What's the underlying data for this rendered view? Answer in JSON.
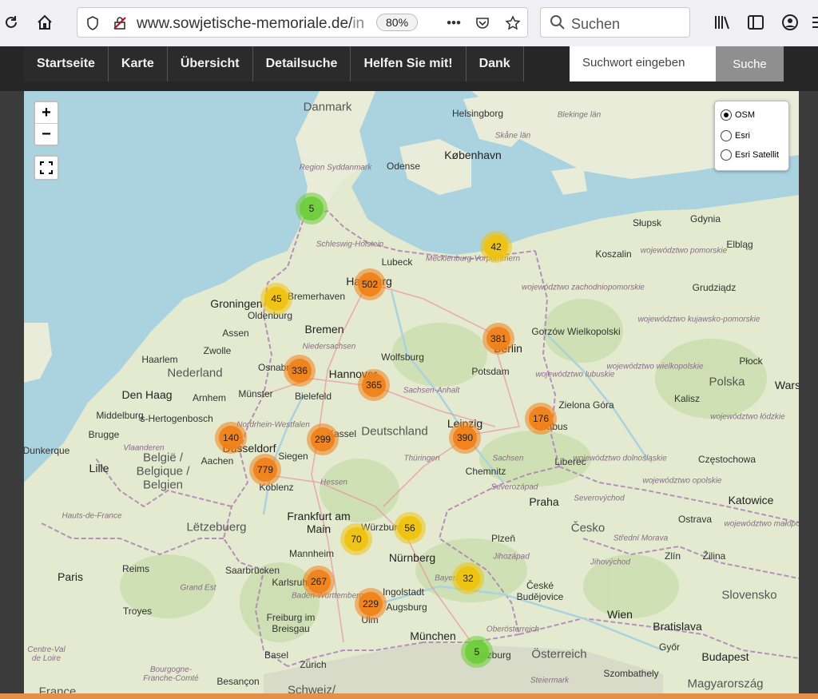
{
  "browser": {
    "url_main": "www.sowjetische-memoriale.de/",
    "url_fade": "in",
    "zoom": "80%",
    "search_placeholder": "Suchen"
  },
  "nav": {
    "items": [
      "Startseite",
      "Karte",
      "Übersicht",
      "Detailsuche",
      "Helfen Sie mit!",
      "Dank"
    ],
    "search_placeholder": "Suchwort eingeben",
    "search_button": "Suche"
  },
  "map": {
    "zoom_in": "+",
    "zoom_out": "−",
    "layers": [
      {
        "label": "OSM",
        "selected": true
      },
      {
        "label": "Esri",
        "selected": false
      },
      {
        "label": "Esri Satellit",
        "selected": false
      }
    ],
    "clusters": [
      {
        "count": "5",
        "size": "small"
      },
      {
        "count": "42",
        "size": "medium"
      },
      {
        "count": "502",
        "size": "large"
      },
      {
        "count": "45",
        "size": "medium"
      },
      {
        "count": "381",
        "size": "large"
      },
      {
        "count": "336",
        "size": "large"
      },
      {
        "count": "365",
        "size": "large"
      },
      {
        "count": "176",
        "size": "large"
      },
      {
        "count": "140",
        "size": "large"
      },
      {
        "count": "299",
        "size": "large"
      },
      {
        "count": "390",
        "size": "large"
      },
      {
        "count": "779",
        "size": "large"
      },
      {
        "count": "56",
        "size": "medium"
      },
      {
        "count": "70",
        "size": "medium"
      },
      {
        "count": "32",
        "size": "medium"
      },
      {
        "count": "267",
        "size": "large"
      },
      {
        "count": "229",
        "size": "large"
      },
      {
        "count": "5",
        "size": "small"
      }
    ],
    "labels": {
      "danmark": "Danmark",
      "helsingborg": "Helsingborg",
      "skane": "Skåne län",
      "kobenhavn": "København",
      "odense": "Odense",
      "syddanmark": "Region Syddanmark",
      "blekinge": "Blekinge län",
      "slupsk": "Słupsk",
      "gdynia": "Gdynia",
      "pomorskie": "województwo pomorskie",
      "elblag": "Elbląg",
      "koszalin": "Koszalin",
      "schleswig": "Schleswig-Holstein",
      "lubeck": "Lubeck",
      "mecklenburg": "Mecklenburg-Vorpommern",
      "zachodnio": "województwo zachodniopomorskie",
      "grudziadz": "Grudziądz",
      "groningen": "Groningen",
      "bremerhaven": "Bremerhaven",
      "hamburg": "Hamburg",
      "oldenburg": "Oldenburg",
      "bremen": "Bremen",
      "assen": "Assen",
      "kujawsko": "województwo kujawsko-pomorskie",
      "gorzow": "Gorzów Wielkopolski",
      "zwolle": "Zwolle",
      "niedersachsen": "Niedersachsen",
      "wolfsburg": "Wolfsburg",
      "potsdam": "Potsdam",
      "haarlem": "Haarlem",
      "lubuskie": "województwo lubuskie",
      "wielkopolskie": "województwo wielkopolskie",
      "plock": "Płock",
      "nederland": "Nederland",
      "hannover": "Hannover",
      "sachsenanhalt": "Sachsen-Anhalt",
      "polska": "Polska",
      "denhaag": "Den Haag",
      "arnhem": "Arnhem",
      "munster": "Münster",
      "bielefeld": "Bielefeld",
      "zielona": "Zielona Góra",
      "kalisz": "Kalisz",
      "warszawa": "Wars",
      "middelburg": "Middelburg",
      "hertogenbosch": "'s-Hertogenbosch",
      "nrw": "Nordrhein-Westfalen",
      "lodzkie": "województwo łódzkie",
      "brugge": "Brugge",
      "vlaanderen": "Vlaanderen",
      "dusseldorf": "Düsseldorf",
      "deutschland": "Deutschland",
      "leipzig": "Leipzig",
      "dunkerque": "Dunkerque",
      "siegen": "Siegen",
      "thuringen": "Thüringen",
      "sachsen": "Sachsen",
      "liberec": "Liberec",
      "dolnoslaskie": "województwo dolnośląskie",
      "czestochowa": "Częstochowa",
      "lille": "Lille",
      "aachen": "Aachen",
      "belgie": "België / Belgique / Belgien",
      "koblenz": "Koblenz",
      "hessen": "Hessen",
      "chemnitz": "Chemnitz",
      "severozapad": "Severozápad",
      "opolskie": "województwo opolskie",
      "hautsdefrance": "Hauts-de-France",
      "praha": "Praha",
      "severovychod": "Severovýchod",
      "katowice": "Katowice",
      "letzebuerg": "Lëtzebuerg",
      "frankfurt": "Frankfurt am Main",
      "wurzburg": "Würzburg",
      "cesko": "Česko",
      "ostrava": "Ostrava",
      "malopolskie": "województwo małopolskie",
      "plzen": "Plzeň",
      "strednimorava": "Střední Morava",
      "mannheim": "Mannheim",
      "nurnberg": "Nürnberg",
      "jihozapad": "Jihozápad",
      "jihovychod": "Jihovýchod",
      "zlin": "Zlín",
      "zilina": "Žilina",
      "paris": "Paris",
      "reims": "Reims",
      "saarbrucken": "Saarbrücken",
      "granderst": "Grand Est",
      "bayern": "Bayern",
      "ceske": "České Budějovice",
      "karlsruhe": "Karlsruhe",
      "badenw": "Baden-Württemberg",
      "ingolstadt": "Ingolstadt",
      "augsburg": "Augsburg",
      "slovensko": "Slovensko",
      "troyes": "Troyes",
      "wien": "Wien",
      "bratislava": "Bratislava",
      "freiburg": "Freiburg im Breisgau",
      "ulm": "Ulm",
      "munchen": "München",
      "oberosterreich": "Oberösterreich",
      "gyor": "Győr",
      "centre": "Centre-Val de Loire",
      "basel": "Basel",
      "zurich": "Zürich",
      "salzburg": "Salzburg",
      "osterreich": "Österreich",
      "budapest": "Budapest",
      "bourgogne": "Bourgogne-Franche-Comté",
      "besancon": "Besançon",
      "schweiz": "Schweiz/",
      "steiermark": "Steiermark",
      "szombathely": "Szombathely",
      "magyarorszag": "Magyarország",
      "france": "France",
      "kassel": "Kassel",
      "berlin": "Berlin",
      "cottbus": "Cottbus",
      "osnabruck": "Osnabrück"
    }
  }
}
